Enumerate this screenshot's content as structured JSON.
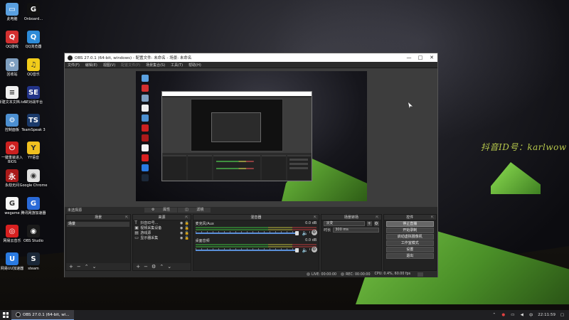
{
  "desktop": {
    "icons": [
      {
        "label": "此电脑",
        "color": "#5aa0e0",
        "glyph": "▭"
      },
      {
        "label": "Onboard...",
        "color": "#111111",
        "glyph": "G"
      },
      {
        "label": "QQ游戏",
        "color": "#d33030",
        "glyph": "Q"
      },
      {
        "label": "QQ浏览器",
        "color": "#2d8bd8",
        "glyph": "Q"
      },
      {
        "label": "回收站",
        "color": "#7f9fc0",
        "glyph": "♻"
      },
      {
        "label": "QQ音乐",
        "color": "#f2cc1a",
        "glyph": "♫"
      },
      {
        "label": "新建文本文档.txt",
        "color": "#f0f0f0",
        "glyph": "≡"
      },
      {
        "label": "SE对战平台",
        "color": "#223388",
        "glyph": "SE"
      },
      {
        "label": "控制面板",
        "color": "#4c8fd0",
        "glyph": "⚙"
      },
      {
        "label": "TeamSpeak 3",
        "color": "#1b3a6a",
        "glyph": "TS"
      },
      {
        "label": "一键重装进入BIOS",
        "color": "#cc2020",
        "glyph": "⏻"
      },
      {
        "label": "YY语音",
        "color": "#f0c020",
        "glyph": "Y"
      },
      {
        "label": "永劫无间",
        "color": "#aa1a1a",
        "glyph": "永"
      },
      {
        "label": "Google Chrome",
        "color": "#e0e0e0",
        "glyph": "◉"
      },
      {
        "label": "wegame",
        "color": "#f6f6f6",
        "glyph": "G"
      },
      {
        "label": "腾讯网游加速器",
        "color": "#2a6ad8",
        "glyph": "G"
      },
      {
        "label": "网易云音乐",
        "color": "#d82020",
        "glyph": "◎"
      },
      {
        "label": "OBS Studio",
        "color": "#1a1a1a",
        "glyph": "◉"
      },
      {
        "label": "网易UU加速器",
        "color": "#2a7ae0",
        "glyph": "U"
      },
      {
        "label": "steam",
        "color": "#1b2838",
        "glyph": "S"
      }
    ],
    "watermark": "抖音ID号：karlwow"
  },
  "obs": {
    "title": "OBS 27.0.1 (64-bit, windows) - 配置文件: 未命名 - 场景: 未命名",
    "menu": [
      "文件(F)",
      "编辑(E)",
      "视图(V)",
      "配置文件(P)",
      "场景集合(S)",
      "工具(T)",
      "帮助(H)"
    ],
    "scene_label": "未选择源",
    "tabs": [
      "属性",
      "滤镜"
    ],
    "docks": {
      "scenes": {
        "title": "场景",
        "items": [
          "场景"
        ]
      },
      "sources": {
        "title": "来源",
        "items": [
          {
            "icon": "T",
            "label": "抖音ID号..."
          },
          {
            "icon": "▣",
            "label": "视频采集设备"
          },
          {
            "icon": "▤",
            "label": "游戏源"
          },
          {
            "icon": "▭",
            "label": "显示器采集"
          }
        ]
      },
      "mixer": {
        "title": "混音器",
        "channels": [
          {
            "name": "麦克风/Aux",
            "db": "0.0 dB"
          },
          {
            "name": "桌面音频",
            "db": "0.0 dB"
          }
        ]
      },
      "transitions": {
        "title": "场景转场",
        "type": "淡变",
        "duration_label": "时长",
        "duration_value": "300 ms"
      },
      "controls": {
        "title": "控件",
        "buttons": [
          "停止直播",
          "开始录制",
          "启动虚拟摄像机",
          "工作室模式",
          "设置",
          "退出"
        ]
      }
    },
    "status": {
      "live_label": "LIVE:",
      "live_time": "00:00:00",
      "rec_label": "REC:",
      "rec_time": "00:00:00",
      "cpu": "CPU: 0.4%, 60.00 fps"
    }
  },
  "taskbar": {
    "task_label": "OBS 27.0.1 (64-bit, wi...",
    "time": "22:11:59"
  }
}
